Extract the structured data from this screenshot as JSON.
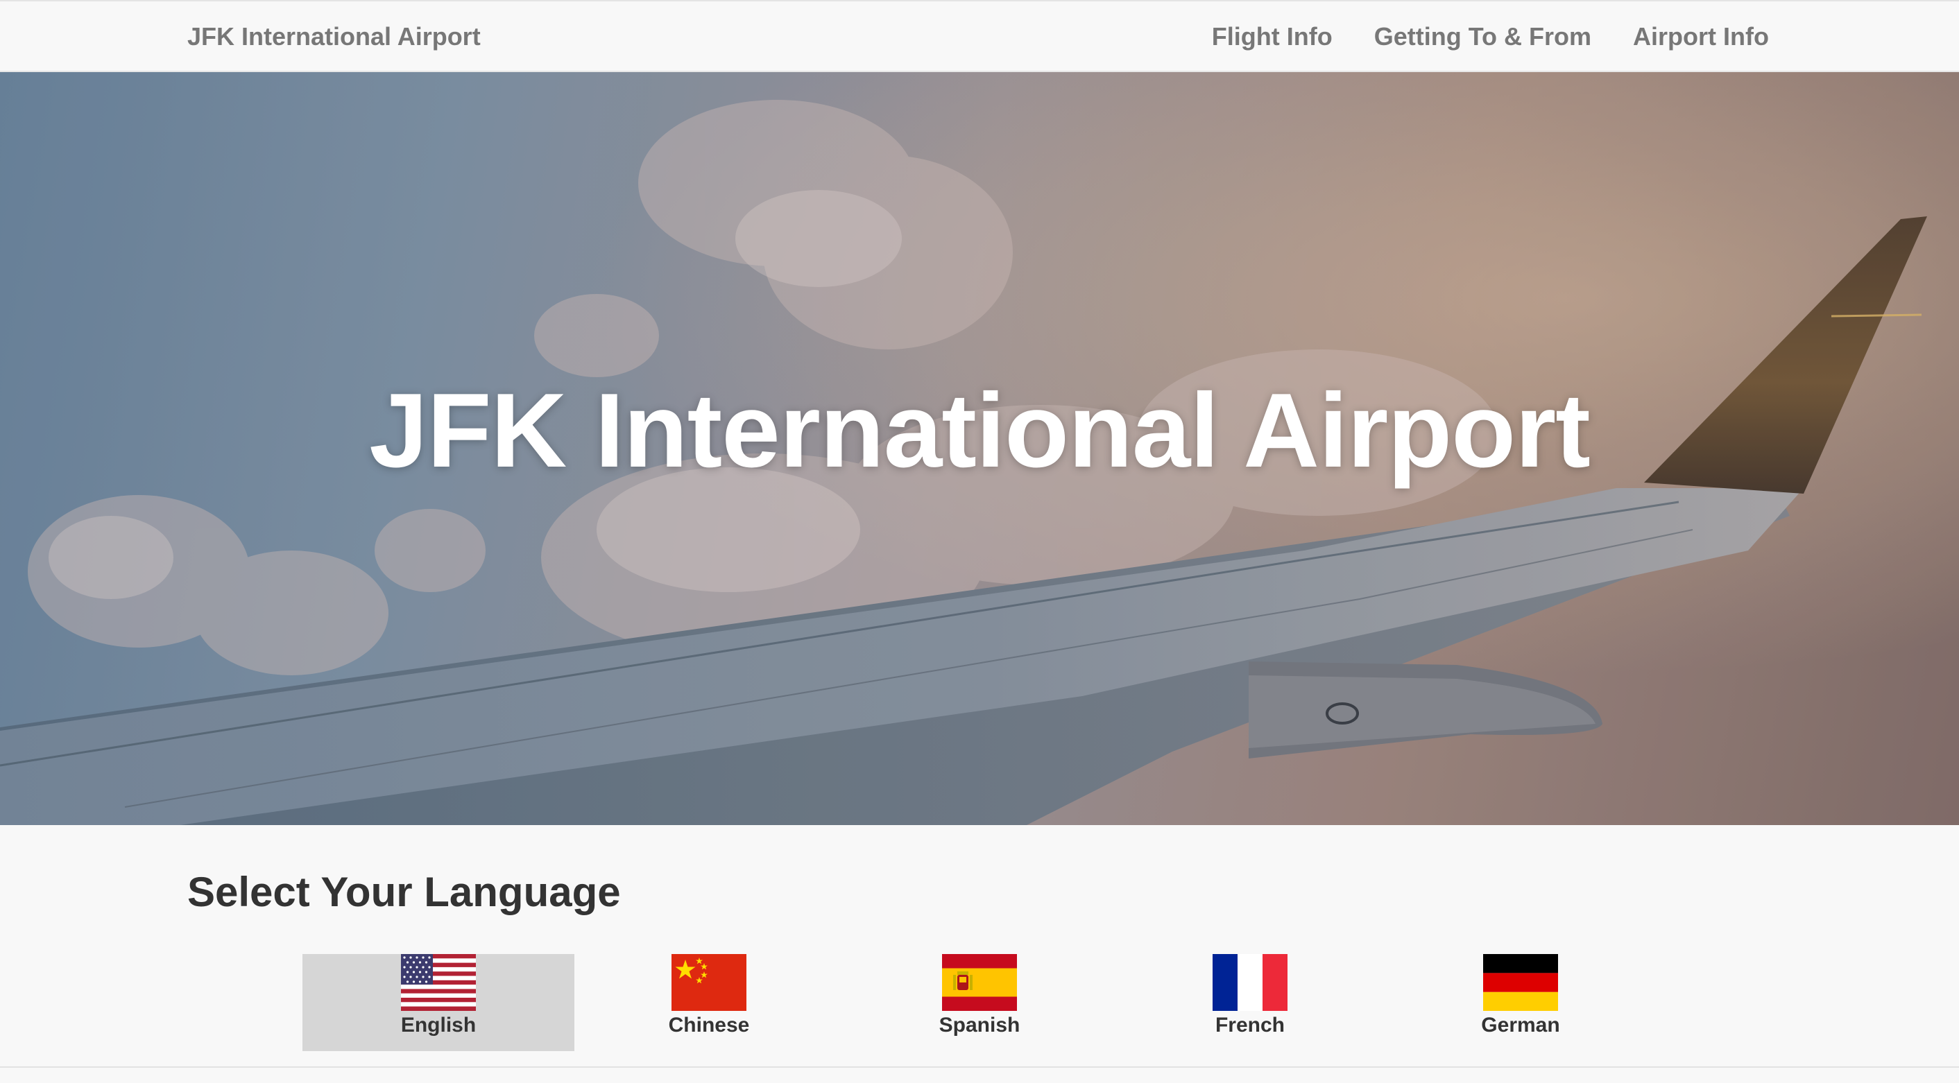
{
  "navbar": {
    "brand": "JFK International Airport",
    "links": [
      {
        "label": "Flight Info"
      },
      {
        "label": "Getting To & From"
      },
      {
        "label": "Airport Info"
      }
    ]
  },
  "hero": {
    "title": "JFK International Airport",
    "background": "airplane wing above clouds"
  },
  "language_section": {
    "heading": "Select Your Language",
    "selected": "English",
    "options": [
      {
        "label": "English",
        "icon": "us-flag-icon"
      },
      {
        "label": "Chinese",
        "icon": "china-flag-icon"
      },
      {
        "label": "Spanish",
        "icon": "spain-flag-icon"
      },
      {
        "label": "French",
        "icon": "france-flag-icon"
      },
      {
        "label": "German",
        "icon": "germany-flag-icon"
      }
    ]
  },
  "colors": {
    "navbar_bg": "#f8f8f8",
    "nav_text": "#777777",
    "selected_bg": "#d6d6d6",
    "heading_text": "#333333"
  }
}
